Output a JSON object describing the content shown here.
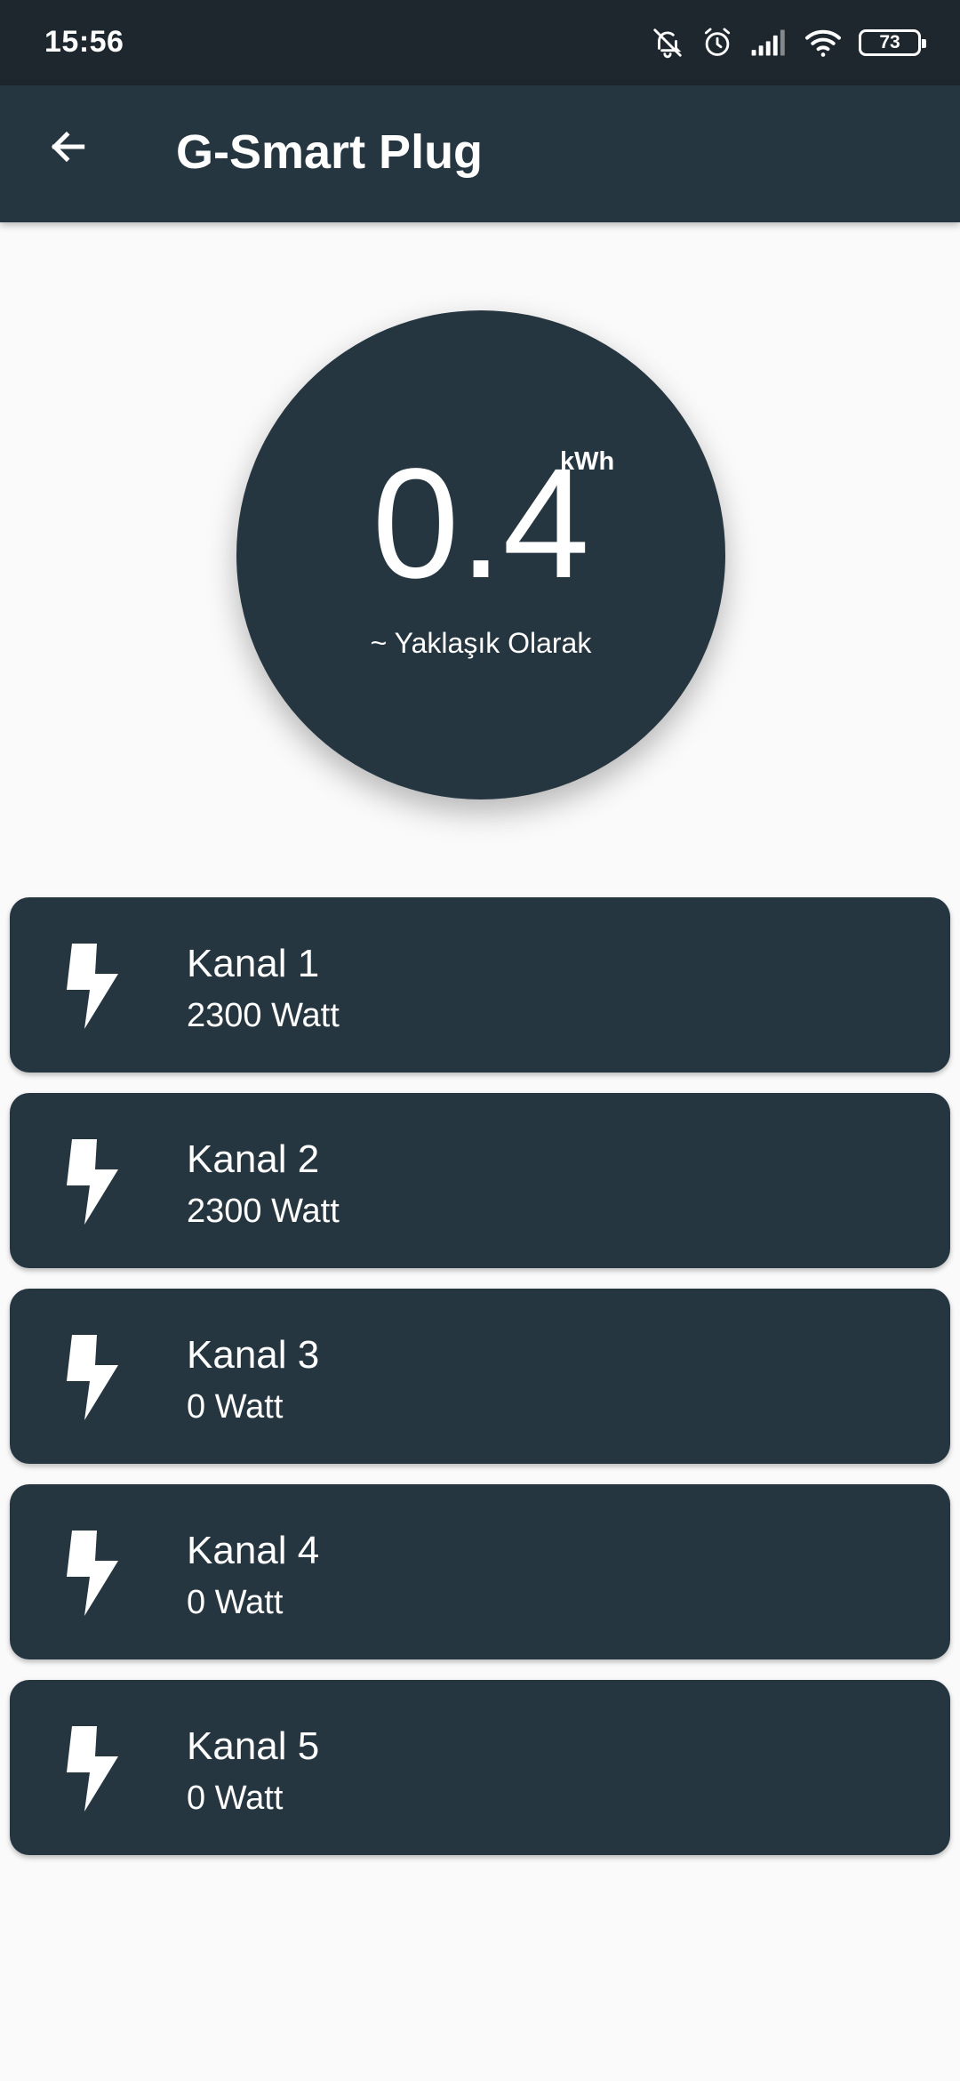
{
  "status_bar": {
    "time": "15:56",
    "battery": "73",
    "icons": [
      "mute-notifications-icon",
      "alarm-icon",
      "signal-icon",
      "wifi-icon",
      "battery-icon"
    ]
  },
  "app_bar": {
    "title": "G-Smart Plug",
    "back_icon": "arrow-left-icon"
  },
  "energy": {
    "value": "0.4",
    "unit": "kWh",
    "caption": "~ Yaklaşık Olarak"
  },
  "channels": [
    {
      "name": "Kanal 1",
      "power": "2300 Watt",
      "icon": "lightning-bolt-icon"
    },
    {
      "name": "Kanal 2",
      "power": "2300 Watt",
      "icon": "lightning-bolt-icon"
    },
    {
      "name": "Kanal 3",
      "power": "0 Watt",
      "icon": "lightning-bolt-icon"
    },
    {
      "name": "Kanal 4",
      "power": "0 Watt",
      "icon": "lightning-bolt-icon"
    },
    {
      "name": "Kanal 5",
      "power": "0 Watt",
      "icon": "lightning-bolt-icon"
    }
  ],
  "colors": {
    "status_bar": "#1d272d",
    "primary": "#263640",
    "background": "#fafafa",
    "text": "#ffffff"
  }
}
